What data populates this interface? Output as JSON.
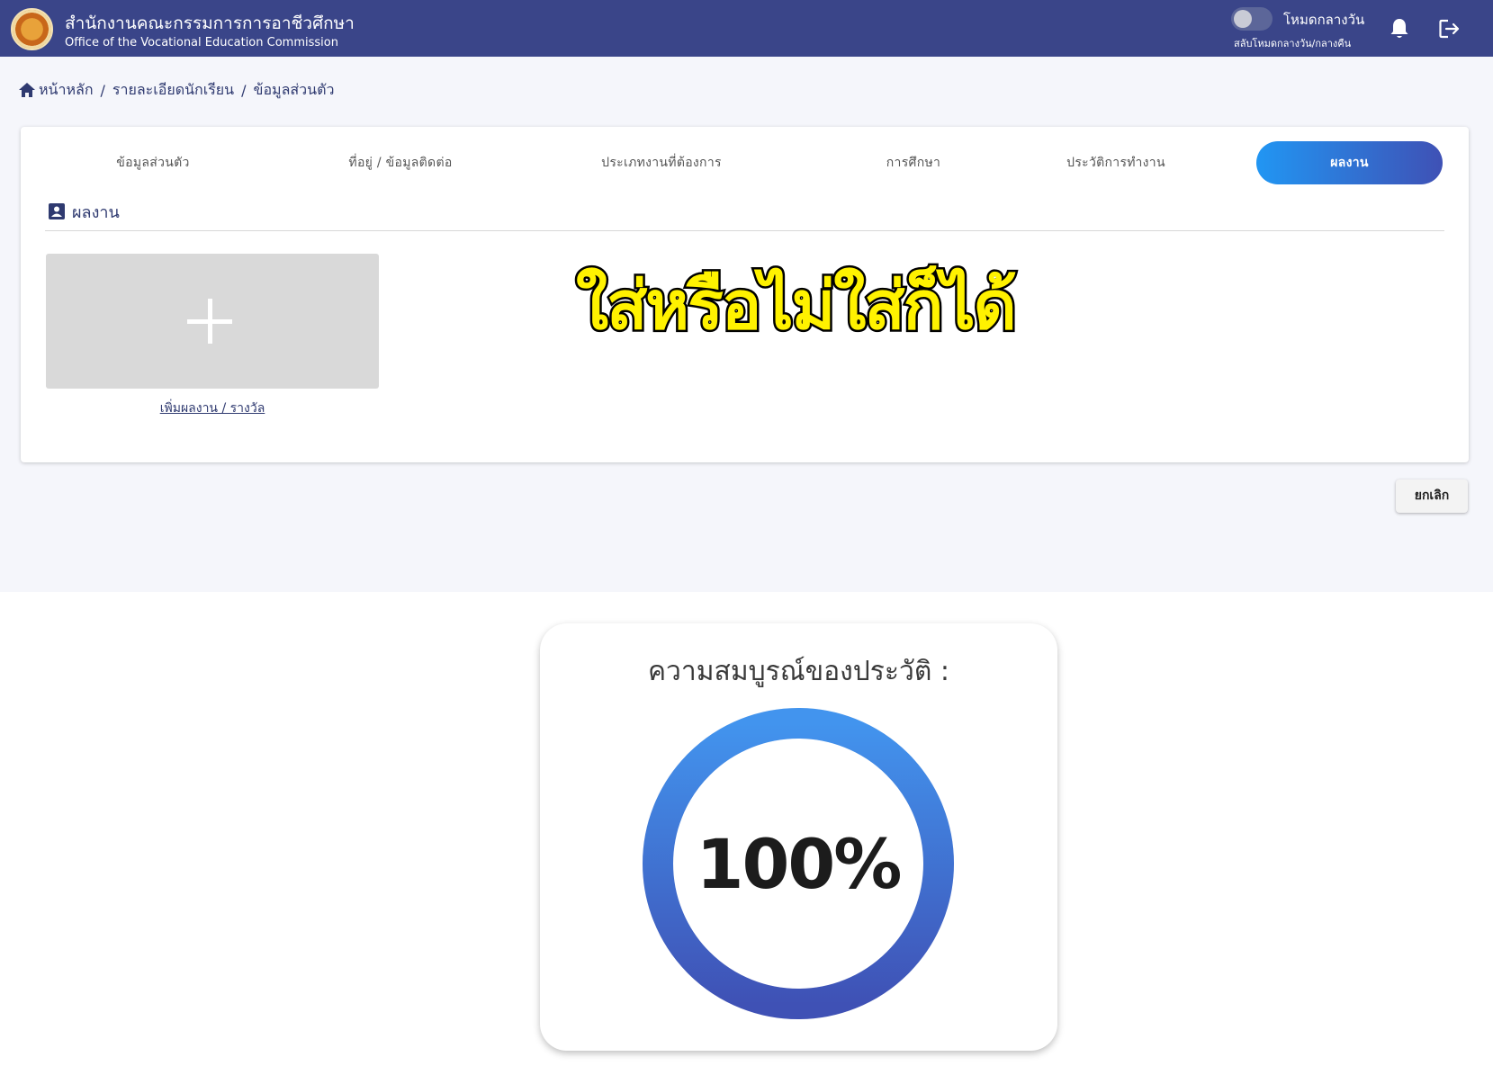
{
  "header": {
    "org_name_th": "สำนักงานคณะกรรมการการอาชีวศึกษา",
    "org_name_en": "Office of the Vocational Education Commission",
    "mode_label": "โหมดกลางวัน",
    "mode_subtitle": "สลับโหมดกลางวัน/กลางคืน"
  },
  "breadcrumb": [
    "หน้าหลัก",
    "รายละเอียดนักเรียน",
    "ข้อมูลส่วนตัว"
  ],
  "tabs": [
    {
      "label": "ข้อมูลส่วนตัว",
      "active": false
    },
    {
      "label": "ที่อยู่ / ข้อมูลติดต่อ",
      "active": false
    },
    {
      "label": "ประเภทงานที่ต้องการ",
      "active": false
    },
    {
      "label": "การศึกษา",
      "active": false
    },
    {
      "label": "ประวัติการทำงาน",
      "active": false
    },
    {
      "label": "ผลงาน",
      "active": true
    }
  ],
  "section": {
    "title": "ผลงาน",
    "add_link": "เพิ่มผลงาน / รางวัล"
  },
  "overlay_text": "ใส่หรือไม่ใส่ก็ได้",
  "actions": {
    "cancel": "ยกเลิก"
  },
  "completion": {
    "title": "ความสมบูรณ์ของประวัติ :",
    "percent_label": "100%",
    "percent": 100
  },
  "colors": {
    "header_bg": "#3a4589",
    "active_tab_start": "#2196f3",
    "active_tab_end": "#3f51b5",
    "overlay_fill": "#fff200"
  },
  "icons": [
    "home-icon",
    "bell-icon",
    "logout-icon",
    "portfolio-icon",
    "plus-icon"
  ]
}
